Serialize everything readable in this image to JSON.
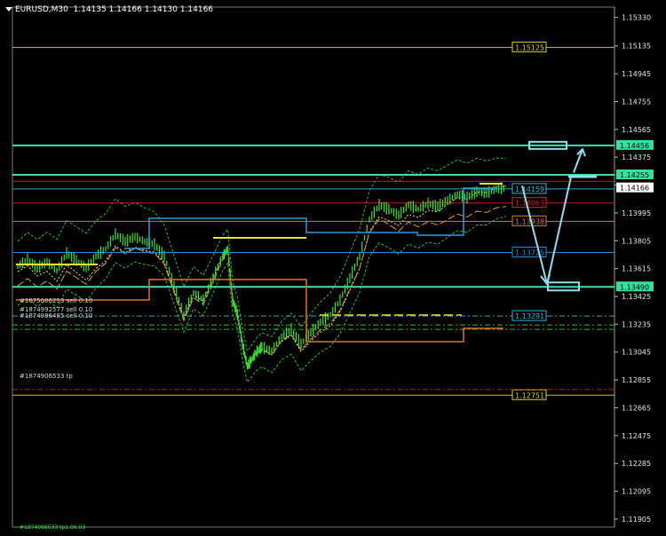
{
  "header": {
    "symbol": "EURUSD,M30",
    "ohlc": "1.14135 1.14166 1.14130 1.14166"
  },
  "orders": [
    "#1875006253 sell 0.10",
    "#1874992577 sell 0.10",
    "#1874986485 sell 0.10",
    "#1874906533 tp"
  ],
  "footer_text": "#1874986533 tp1.06.03",
  "chart_data": {
    "type": "line",
    "title": "EURUSD,M30",
    "y_axis": {
      "min": 1.1185,
      "max": 1.154,
      "ticks": [
        "1.15330",
        "1.15135",
        "1.14945",
        "1.14755",
        "1.14565",
        "1.14375",
        "1.14185",
        "1.13995",
        "1.13805",
        "1.13615",
        "1.13425",
        "1.13235",
        "1.13045",
        "1.12855",
        "1.12665",
        "1.12475",
        "1.12285",
        "1.12095",
        "1.11905"
      ]
    },
    "current_price": {
      "value": 1.14166,
      "label": "1.14166"
    },
    "x_domain": [
      0,
      100
    ],
    "levels": [
      {
        "value": 1.15125,
        "label": "1.15125",
        "color": "#c8c800",
        "style": "solid",
        "box": "yellow"
      },
      {
        "value": 1.14456,
        "label": "1.14456",
        "color": "#3fe0b0",
        "style": "solid",
        "box": "axis-green"
      },
      {
        "value": 1.14255,
        "label": "1.14255",
        "color": "#3fe0b0",
        "style": "solid",
        "box": "axis-green"
      },
      {
        "value": 1.1421,
        "label": "",
        "color": "#e01010",
        "style": "solid",
        "box": ""
      },
      {
        "value": 1.14159,
        "label": "1.14159",
        "color": "#2aa8d8",
        "style": "solid",
        "box": "cyan"
      },
      {
        "value": 1.14063,
        "label": "1.14063",
        "color": "#d01818",
        "style": "solid",
        "box": "red"
      },
      {
        "value": 1.13938,
        "label": "1.13938",
        "color": "#d87818",
        "style": "solid",
        "box": "orange"
      },
      {
        "value": 1.13725,
        "label": "1.13725",
        "color": "#2a8ad8",
        "style": "solid",
        "box": "blue"
      },
      {
        "value": 1.1349,
        "label": "1.13490",
        "color": "#3fe0b0",
        "style": "solid",
        "box": "axis-green"
      },
      {
        "value": 1.13291,
        "label": "1.13291",
        "color": "#2aa8b8",
        "style": "dashdot",
        "box": "cyan"
      },
      {
        "value": 1.1323,
        "label": "",
        "color": "#22b822",
        "style": "dashdot",
        "box": ""
      },
      {
        "value": 1.132,
        "label": "",
        "color": "#22b822",
        "style": "dashdot",
        "box": ""
      },
      {
        "value": 1.12751,
        "label": "1.12751",
        "color": "#c8c800",
        "style": "solid",
        "box": "yellow"
      },
      {
        "value": 1.1279,
        "label": "",
        "color": "#c81818",
        "style": "dashdot",
        "box": ""
      }
    ],
    "price_series": {
      "x": [
        0,
        2,
        4,
        6,
        8,
        10,
        12,
        14,
        16,
        18,
        20,
        22,
        24,
        26,
        28,
        30,
        32,
        34,
        36,
        38,
        40,
        42,
        43,
        44,
        45,
        46,
        47,
        48,
        49,
        50,
        52,
        54,
        56,
        58,
        60,
        62,
        64,
        66,
        68,
        70,
        72,
        74,
        76,
        78,
        80,
        82,
        84,
        86,
        88,
        90,
        92,
        94,
        96,
        98,
        100
      ],
      "y": [
        1.1363,
        1.1368,
        1.1362,
        1.1366,
        1.136,
        1.1372,
        1.1367,
        1.1362,
        1.137,
        1.1375,
        1.1385,
        1.138,
        1.1383,
        1.138,
        1.1378,
        1.137,
        1.135,
        1.133,
        1.1345,
        1.134,
        1.1355,
        1.137,
        1.1375,
        1.134,
        1.133,
        1.131,
        1.1295,
        1.13,
        1.1305,
        1.1308,
        1.1305,
        1.1315,
        1.132,
        1.131,
        1.1318,
        1.1325,
        1.133,
        1.134,
        1.1355,
        1.137,
        1.1395,
        1.1405,
        1.1402,
        1.1398,
        1.1405,
        1.1402,
        1.1406,
        1.1404,
        1.1408,
        1.1412,
        1.141,
        1.1414,
        1.1413,
        1.1416,
        1.14166
      ]
    },
    "scenario_arrows": [
      {
        "from": [
          1.1418
        ],
        "to": [
          1.1351
        ]
      },
      {
        "from": [
          1.1351
        ],
        "to": [
          1.1424
        ]
      },
      {
        "from": [
          1.1424
        ],
        "to": [
          1.1443
        ]
      }
    ]
  }
}
